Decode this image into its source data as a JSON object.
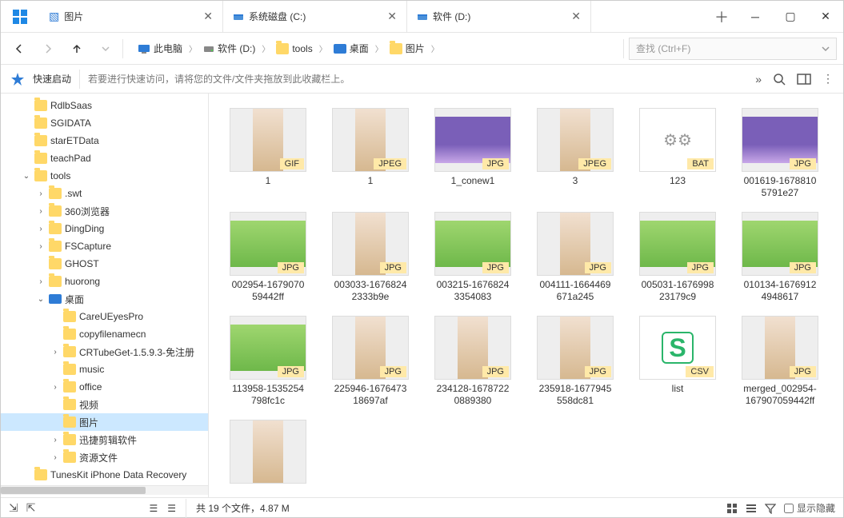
{
  "tabs": [
    {
      "label": "图片",
      "icon": "picture",
      "active": true
    },
    {
      "label": "系统磁盘 (C:)",
      "icon": "drive",
      "active": false
    },
    {
      "label": "软件 (D:)",
      "icon": "drive",
      "active": false
    }
  ],
  "breadcrumb": [
    {
      "label": "此电脑",
      "icon": "pc"
    },
    {
      "label": "软件 (D:)",
      "icon": "drive"
    },
    {
      "label": "tools",
      "icon": "folder"
    },
    {
      "label": "桌面",
      "icon": "desktop"
    },
    {
      "label": "图片",
      "icon": "folder"
    }
  ],
  "search_placeholder": "查找 (Ctrl+F)",
  "quick_launch": "快速启动",
  "quick_hint": "若要进行快速访问，请将您的文件/文件夹拖放到此收藏栏上。",
  "tree": [
    {
      "depth": 1,
      "exp": "none",
      "icon": "folder",
      "label": "RdlbSaas"
    },
    {
      "depth": 1,
      "exp": "none",
      "icon": "folder",
      "label": "SGIDATA"
    },
    {
      "depth": 1,
      "exp": "none",
      "icon": "folder",
      "label": "starETData"
    },
    {
      "depth": 1,
      "exp": "none",
      "icon": "folder",
      "label": "teachPad"
    },
    {
      "depth": 1,
      "exp": "open",
      "icon": "folder",
      "label": "tools"
    },
    {
      "depth": 2,
      "exp": "closed",
      "icon": "folder",
      "label": ".swt"
    },
    {
      "depth": 2,
      "exp": "closed",
      "icon": "folder",
      "label": "360浏览器"
    },
    {
      "depth": 2,
      "exp": "closed",
      "icon": "folder",
      "label": "DingDing"
    },
    {
      "depth": 2,
      "exp": "closed",
      "icon": "folder",
      "label": "FSCapture"
    },
    {
      "depth": 2,
      "exp": "none",
      "icon": "folder",
      "label": "GHOST"
    },
    {
      "depth": 2,
      "exp": "closed",
      "icon": "folder",
      "label": "huorong"
    },
    {
      "depth": 2,
      "exp": "open",
      "icon": "desktop",
      "label": "桌面"
    },
    {
      "depth": 3,
      "exp": "none",
      "icon": "folder",
      "label": "CareUEyesPro"
    },
    {
      "depth": 3,
      "exp": "none",
      "icon": "folder",
      "label": "copyfilenamecn"
    },
    {
      "depth": 3,
      "exp": "closed",
      "icon": "folder",
      "label": "CRTubeGet-1.5.9.3-免注册"
    },
    {
      "depth": 3,
      "exp": "none",
      "icon": "folder",
      "label": "music"
    },
    {
      "depth": 3,
      "exp": "closed",
      "icon": "folder",
      "label": "office"
    },
    {
      "depth": 3,
      "exp": "none",
      "icon": "folder",
      "label": "视频"
    },
    {
      "depth": 3,
      "exp": "none",
      "icon": "folder",
      "label": "图片",
      "selected": true
    },
    {
      "depth": 3,
      "exp": "closed",
      "icon": "folder",
      "label": "迅捷剪辑软件"
    },
    {
      "depth": 3,
      "exp": "closed",
      "icon": "folder",
      "label": "资源文件"
    },
    {
      "depth": 1,
      "exp": "none",
      "icon": "folder",
      "label": "TunesKit iPhone Data Recovery"
    }
  ],
  "files": [
    {
      "name": "1",
      "badge": "GIF",
      "thumb": "portrait"
    },
    {
      "name": "1",
      "badge": "JPEG",
      "thumb": "portrait"
    },
    {
      "name": "1_conew1",
      "badge": "JPG",
      "thumb": "landscape"
    },
    {
      "name": "3",
      "badge": "JPEG",
      "thumb": "portrait"
    },
    {
      "name": "123",
      "badge": "BAT",
      "thumb": "bat"
    },
    {
      "name": "001619-1678810\n5791e27",
      "badge": "JPG",
      "thumb": "landscape"
    },
    {
      "name": "002954-1679070\n59442ff",
      "badge": "JPG",
      "thumb": "green"
    },
    {
      "name": "003033-1676824\n2333b9e",
      "badge": "JPG",
      "thumb": "portrait"
    },
    {
      "name": "003215-1676824\n3354083",
      "badge": "JPG",
      "thumb": "green"
    },
    {
      "name": "004111-1664469\n671a245",
      "badge": "JPG",
      "thumb": "portrait"
    },
    {
      "name": "005031-1676998\n23179c9",
      "badge": "JPG",
      "thumb": "green"
    },
    {
      "name": "010134-1676912\n4948617",
      "badge": "JPG",
      "thumb": "green"
    },
    {
      "name": "113958-1535254\n798fc1c",
      "badge": "JPG",
      "thumb": "green"
    },
    {
      "name": "225946-1676473\n18697af",
      "badge": "JPG",
      "thumb": "portrait"
    },
    {
      "name": "234128-1678722\n0889380",
      "badge": "JPG",
      "thumb": "portrait"
    },
    {
      "name": "235918-1677945\n558dc81",
      "badge": "JPG",
      "thumb": "portrait"
    },
    {
      "name": "list",
      "badge": "CSV",
      "thumb": "csv"
    },
    {
      "name": "merged_002954-\n167907059442ff",
      "badge": "JPG",
      "thumb": "portrait"
    },
    {
      "name": "",
      "badge": "",
      "thumb": "portrait"
    }
  ],
  "status": "共 19 个文件，4.87 M",
  "show_hidden": "显示隐藏"
}
